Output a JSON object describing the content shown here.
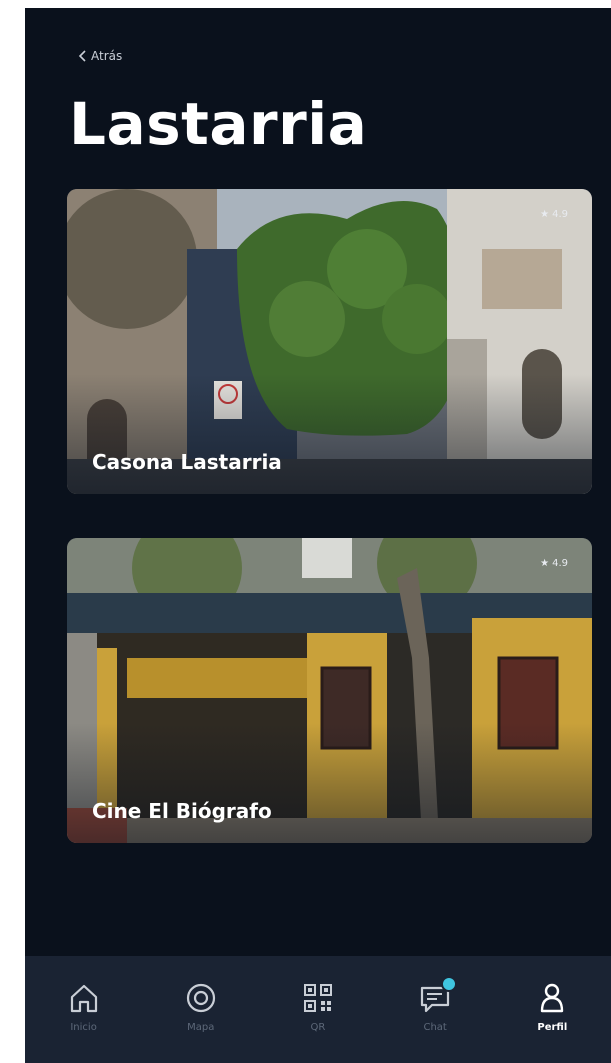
{
  "header": {
    "back_label": "Atrás",
    "title": "Lastarria"
  },
  "places": [
    {
      "name": "Casona Lastarria",
      "rating": "4.9"
    },
    {
      "name": "Cine El Biógrafo",
      "rating": "4.9"
    }
  ],
  "tabbar": {
    "items": [
      {
        "label": "Inicio",
        "icon": "home-icon"
      },
      {
        "label": "Mapa",
        "icon": "target-icon"
      },
      {
        "label": "QR",
        "icon": "qr-code-icon"
      },
      {
        "label": "Chat",
        "icon": "chat-icon"
      },
      {
        "label": "Perfil",
        "icon": "profile-icon"
      }
    ],
    "active": "Perfil"
  },
  "colors": {
    "background": "#0a111c",
    "tabbar": "#1a2333",
    "accent": "#3fc5e0"
  }
}
